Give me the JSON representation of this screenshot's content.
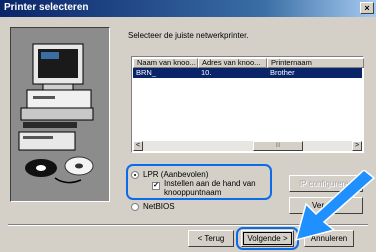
{
  "window": {
    "title": "Printer selecteren",
    "close_icon": "×"
  },
  "instruction": "Selecteer de juiste netwerkprinter.",
  "list": {
    "columns": [
      "Naam van knoo...",
      "Adres van knoo...",
      "Printernaam"
    ],
    "rows": [
      {
        "node_name": "BRN_",
        "node_address": "10.",
        "printer_name": "Brother"
      }
    ],
    "scroll_left": "<",
    "scroll_right": ">",
    "scroll_thumb": "III"
  },
  "options": {
    "lpr_label": "LPR (Aanbevolen)",
    "lpr_selected": true,
    "manual_label_line1": "Instellen aan de hand van",
    "manual_label_line2": "knooppuntnaam",
    "manual_checked": true,
    "netbios_label": "NetBIOS"
  },
  "buttons": {
    "ip_config": "IP configureren",
    "ver": "Ver",
    "back": "< Terug",
    "next": "Volgende >",
    "cancel": "Annuleren"
  },
  "colors": {
    "highlight": "#0a6ce8",
    "arrow": "#1e90ff",
    "titlebar": "#0a246a"
  }
}
